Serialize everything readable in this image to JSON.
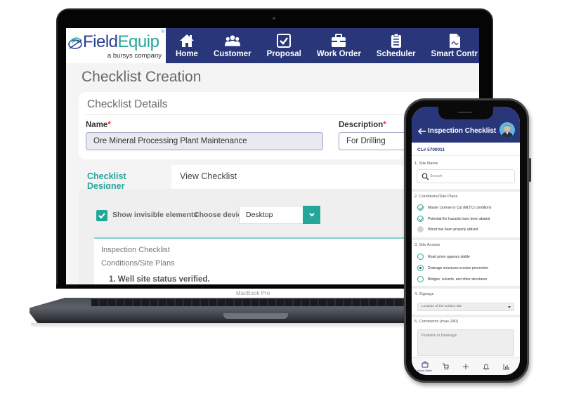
{
  "laptop": {
    "brand_label": "MacBook Pro",
    "app": {
      "logo": {
        "name_part1": "Field",
        "name_part2": "Equip",
        "registered": "®",
        "tagline": "a bursys company"
      },
      "nav_items": [
        {
          "label": "Home",
          "icon": "home-icon"
        },
        {
          "label": "Customer",
          "icon": "users-icon"
        },
        {
          "label": "Proposal",
          "icon": "checkbox-icon"
        },
        {
          "label": "Work Order",
          "icon": "briefcase-icon"
        },
        {
          "label": "Scheduler",
          "icon": "clipboard-list-icon"
        },
        {
          "label": "Smart Contr",
          "icon": "document-icon"
        }
      ],
      "page_title": "Checklist Creation",
      "details": {
        "title": "Checklist Details",
        "name_label": "Name",
        "name_value": "Ore Mineral Processing Plant Maintenance",
        "description_label": "Description",
        "description_value": "For Drilling",
        "required_marker": "*"
      },
      "tabs": [
        {
          "label": "Checklist Designer",
          "active": true
        },
        {
          "label": "View Checklist",
          "active": false
        }
      ],
      "designer": {
        "show_invisible_label": "Show invisible elements",
        "show_invisible_checked": true,
        "choose_device_label": "Choose device",
        "device_value": "Desktop",
        "canvas_lines": [
          "Inspection Checklist",
          "Conditions/Site Plans"
        ],
        "first_item": "1. Well site status verified."
      }
    }
  },
  "phone": {
    "header_title": "Inspection Checklist",
    "checklist_id": "CL# 5700011",
    "sections": {
      "site_name": {
        "label": "1. Site Name",
        "search_placeholder": "Search"
      },
      "conditions": {
        "label": "2. Conditions/Site Plans",
        "items": [
          {
            "text": "Master License to Cut (MLTC) conditions",
            "checked": true
          },
          {
            "text": "Potential fire hazards have been abated",
            "checked": true
          },
          {
            "text": "Wood has been properly utilized",
            "checked": false
          }
        ]
      },
      "site_access": {
        "label": "3. Site Access",
        "options": [
          {
            "text": "Road prism appears stable",
            "selected": false
          },
          {
            "text": "Drainage structures erosion prevention",
            "selected": true
          },
          {
            "text": "Bridges, culverts, and other structures",
            "selected": false
          }
        ]
      },
      "signage": {
        "label": "4. Signage",
        "selected_value": "Location of the surface site"
      },
      "comments": {
        "label": "5. Comments (max.240)",
        "value": "Problem in Drainage"
      }
    },
    "tabbar": [
      {
        "label": "Work Order",
        "icon": "briefcase-icon"
      },
      {
        "label": "",
        "icon": "cart-icon"
      },
      {
        "label": "",
        "icon": "plus-icon"
      },
      {
        "label": "",
        "icon": "bell-icon"
      },
      {
        "label": "",
        "icon": "chart-icon"
      }
    ],
    "accent_color": "#29377a"
  },
  "colors": {
    "nav_bg": "#29377a",
    "teal": "#26a69a",
    "required": "#e53935"
  }
}
